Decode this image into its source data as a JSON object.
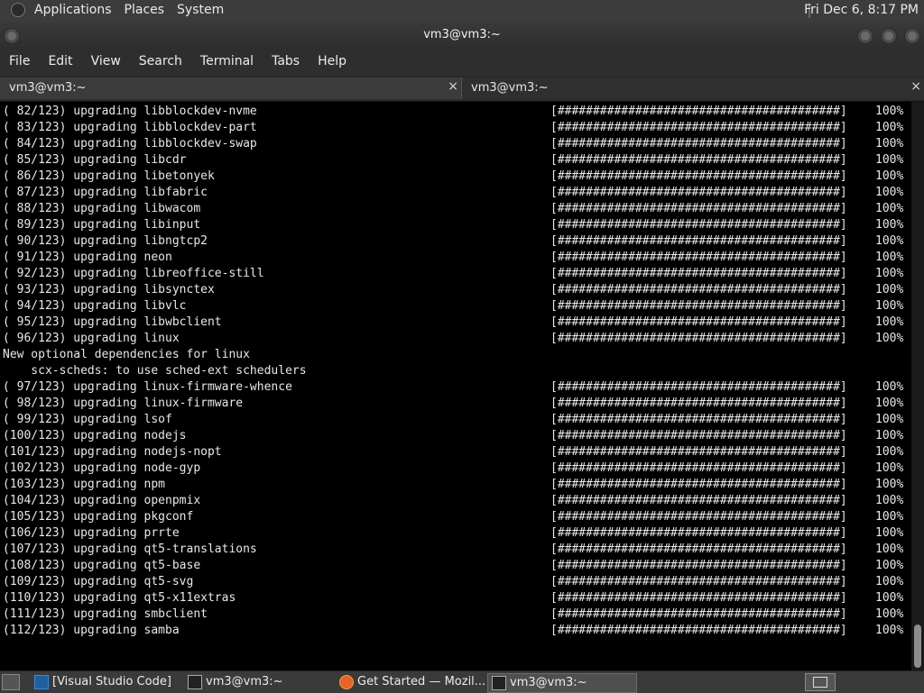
{
  "top_panel": {
    "menus": [
      "Applications",
      "Places",
      "System"
    ],
    "clock": "Fri Dec  6,  8:17 PM"
  },
  "window": {
    "title": "vm3@vm3:~",
    "menu": [
      "File",
      "Edit",
      "View",
      "Search",
      "Terminal",
      "Tabs",
      "Help"
    ],
    "tabs": [
      {
        "label": "vm3@vm3:~",
        "close": "×"
      },
      {
        "label": "vm3@vm3:~",
        "close": "×"
      }
    ]
  },
  "terminal": {
    "bar_text": "[########################################]",
    "lines": [
      {
        "text": "( 82/123) upgrading libblockdev-nvme",
        "pct": "100%"
      },
      {
        "text": "( 83/123) upgrading libblockdev-part",
        "pct": "100%"
      },
      {
        "text": "( 84/123) upgrading libblockdev-swap",
        "pct": "100%"
      },
      {
        "text": "( 85/123) upgrading libcdr",
        "pct": "100%"
      },
      {
        "text": "( 86/123) upgrading libetonyek",
        "pct": "100%"
      },
      {
        "text": "( 87/123) upgrading libfabric",
        "pct": "100%"
      },
      {
        "text": "( 88/123) upgrading libwacom",
        "pct": "100%"
      },
      {
        "text": "( 89/123) upgrading libinput",
        "pct": "100%"
      },
      {
        "text": "( 90/123) upgrading libngtcp2",
        "pct": "100%"
      },
      {
        "text": "( 91/123) upgrading neon",
        "pct": "100%"
      },
      {
        "text": "( 92/123) upgrading libreoffice-still",
        "pct": "100%"
      },
      {
        "text": "( 93/123) upgrading libsynctex",
        "pct": "100%"
      },
      {
        "text": "( 94/123) upgrading libvlc",
        "pct": "100%"
      },
      {
        "text": "( 95/123) upgrading libwbclient",
        "pct": "100%"
      },
      {
        "text": "( 96/123) upgrading linux",
        "pct": "100%"
      },
      {
        "text": "New optional dependencies for linux",
        "pct": ""
      },
      {
        "text": "    scx-scheds: to use sched-ext schedulers",
        "pct": ""
      },
      {
        "text": "( 97/123) upgrading linux-firmware-whence",
        "pct": "100%"
      },
      {
        "text": "( 98/123) upgrading linux-firmware",
        "pct": "100%"
      },
      {
        "text": "( 99/123) upgrading lsof",
        "pct": "100%"
      },
      {
        "text": "(100/123) upgrading nodejs",
        "pct": "100%"
      },
      {
        "text": "(101/123) upgrading nodejs-nopt",
        "pct": "100%"
      },
      {
        "text": "(102/123) upgrading node-gyp",
        "pct": "100%"
      },
      {
        "text": "(103/123) upgrading npm",
        "pct": "100%"
      },
      {
        "text": "(104/123) upgrading openpmix",
        "pct": "100%"
      },
      {
        "text": "(105/123) upgrading pkgconf",
        "pct": "100%"
      },
      {
        "text": "(106/123) upgrading prrte",
        "pct": "100%"
      },
      {
        "text": "(107/123) upgrading qt5-translations",
        "pct": "100%"
      },
      {
        "text": "(108/123) upgrading qt5-base",
        "pct": "100%"
      },
      {
        "text": "(109/123) upgrading qt5-svg",
        "pct": "100%"
      },
      {
        "text": "(110/123) upgrading qt5-x11extras",
        "pct": "100%"
      },
      {
        "text": "(111/123) upgrading smbclient",
        "pct": "100%"
      },
      {
        "text": "(112/123) upgrading samba",
        "pct": "100%"
      }
    ]
  },
  "taskbar": {
    "items": [
      {
        "label": "[Visual Studio Code]",
        "icon": "vscode-icon"
      },
      {
        "label": "vm3@vm3:~",
        "icon": "terminal-icon"
      },
      {
        "label": "Get Started — Mozil...",
        "icon": "firefox-icon"
      },
      {
        "label": "vm3@vm3:~",
        "icon": "terminal-icon"
      }
    ]
  }
}
